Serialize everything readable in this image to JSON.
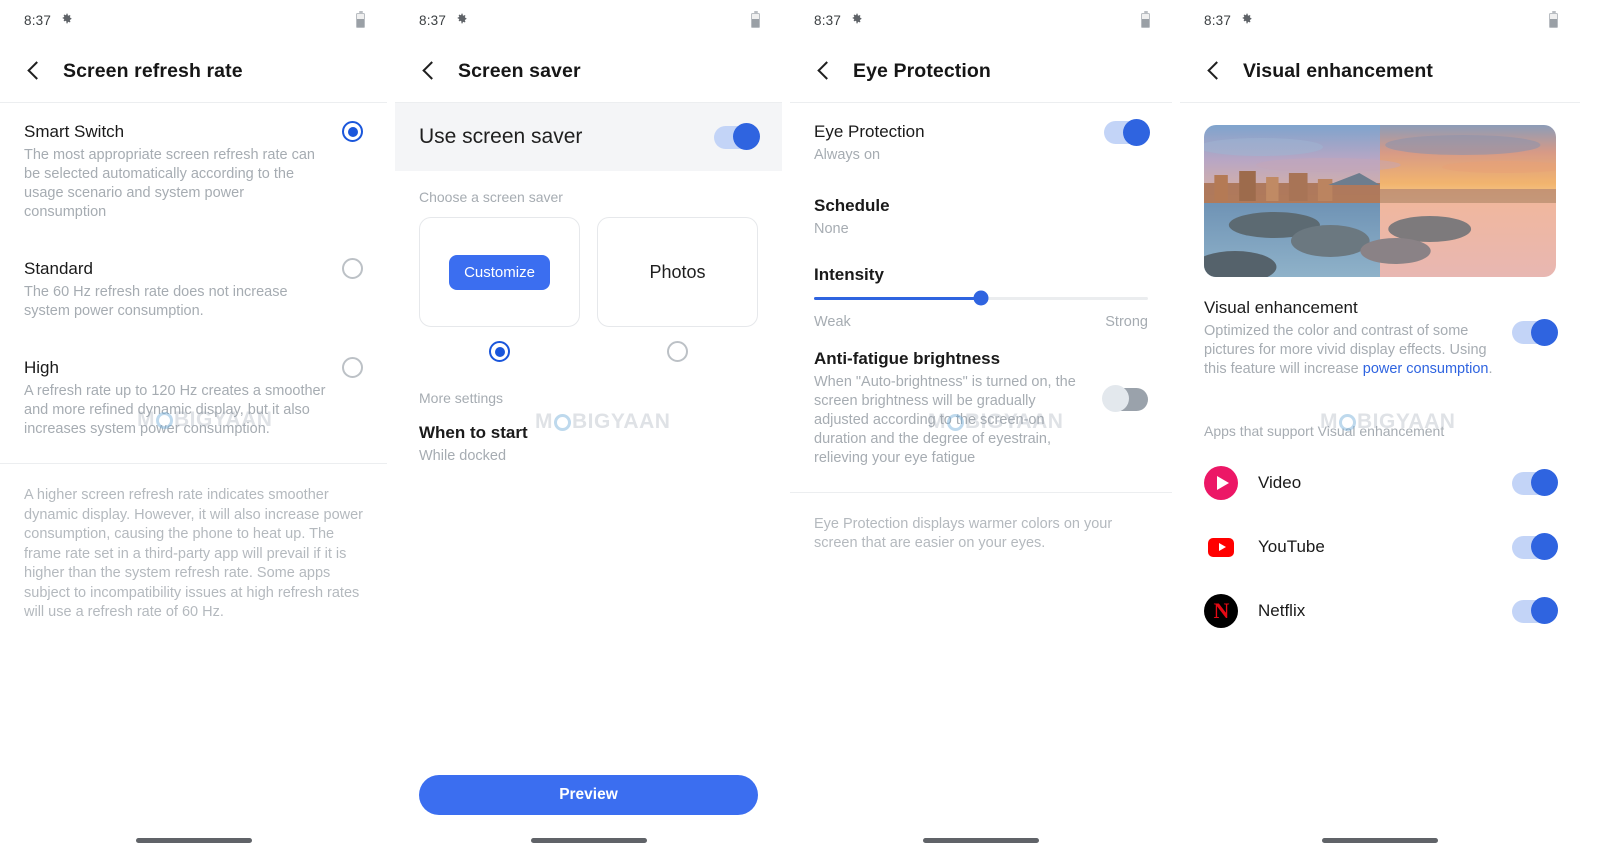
{
  "status": {
    "time": "8:37",
    "gear_icon": "gear-icon",
    "battery_icon": "battery-icon"
  },
  "watermark": {
    "pre": "M",
    "post": "BIGYAAN"
  },
  "panel1": {
    "title": "Screen refresh rate",
    "options": [
      {
        "title": "Smart Switch",
        "sub": "The most appropriate screen refresh rate can be selected automatically according to the usage scenario and system power consumption",
        "selected": true
      },
      {
        "title": "Standard",
        "sub": "The 60 Hz refresh rate does not increase system power consumption.",
        "selected": false
      },
      {
        "title": "High",
        "sub": "A refresh rate up to 120 Hz creates a smoother and more refined dynamic display, but it also increases system power consumption.",
        "selected": false
      }
    ],
    "note": "A higher screen refresh rate indicates smoother dynamic display. However, it will also increase power consumption, causing the phone to heat up. The frame rate set in a third-party app will prevail if it is higher than the system refresh rate. Some apps subject to incompatibility issues at high refresh rates will use a refresh rate of 60 Hz."
  },
  "panel2": {
    "title": "Screen saver",
    "use_screen_saver": {
      "label": "Use screen saver",
      "on": true
    },
    "choose_label": "Choose a screen saver",
    "cards": [
      {
        "label": "Customize",
        "type": "chip",
        "selected": true
      },
      {
        "label": "Photos",
        "type": "text",
        "selected": false
      }
    ],
    "more_settings_label": "More settings",
    "when_to_start": {
      "title": "When to start",
      "sub": "While docked"
    },
    "preview_button": "Preview"
  },
  "panel3": {
    "title": "Eye Protection",
    "eye_protection": {
      "title": "Eye Protection",
      "sub": "Always on",
      "on": true
    },
    "schedule": {
      "title": "Schedule",
      "sub": "None"
    },
    "intensity": {
      "title": "Intensity",
      "value": 50,
      "min_label": "Weak",
      "max_label": "Strong"
    },
    "anti_fatigue": {
      "title": "Anti-fatigue brightness",
      "sub": "When \"Auto-brightness\" is turned on, the screen brightness will be gradually adjusted according to the screen-on duration and the degree of eyestrain, relieving your eye fatigue",
      "on": false
    },
    "note": "Eye Protection displays warmer colors on your screen that are easier on your eyes."
  },
  "panel4": {
    "title": "Visual enhancement",
    "hero_image": "seaside-sunset-comparison-image",
    "main": {
      "title": "Visual enhancement",
      "sub_a": "Optimized the color and contrast of some pictures for more vivid display effects. Using this feature will increase ",
      "sub_link": "power consumption",
      "sub_b": ".",
      "on": true
    },
    "apps_label": "Apps that support Visual enhancement",
    "apps": [
      {
        "name": "Video",
        "icon": "video-app-icon",
        "on": true
      },
      {
        "name": "YouTube",
        "icon": "youtube-app-icon",
        "on": true
      },
      {
        "name": "Netflix",
        "icon": "netflix-app-icon",
        "on": true
      }
    ]
  },
  "colors": {
    "accent": "#2f64e0",
    "chip": "#3b6ef0",
    "link": "#2f64e0",
    "toggle_off": "#9aa2ab"
  }
}
